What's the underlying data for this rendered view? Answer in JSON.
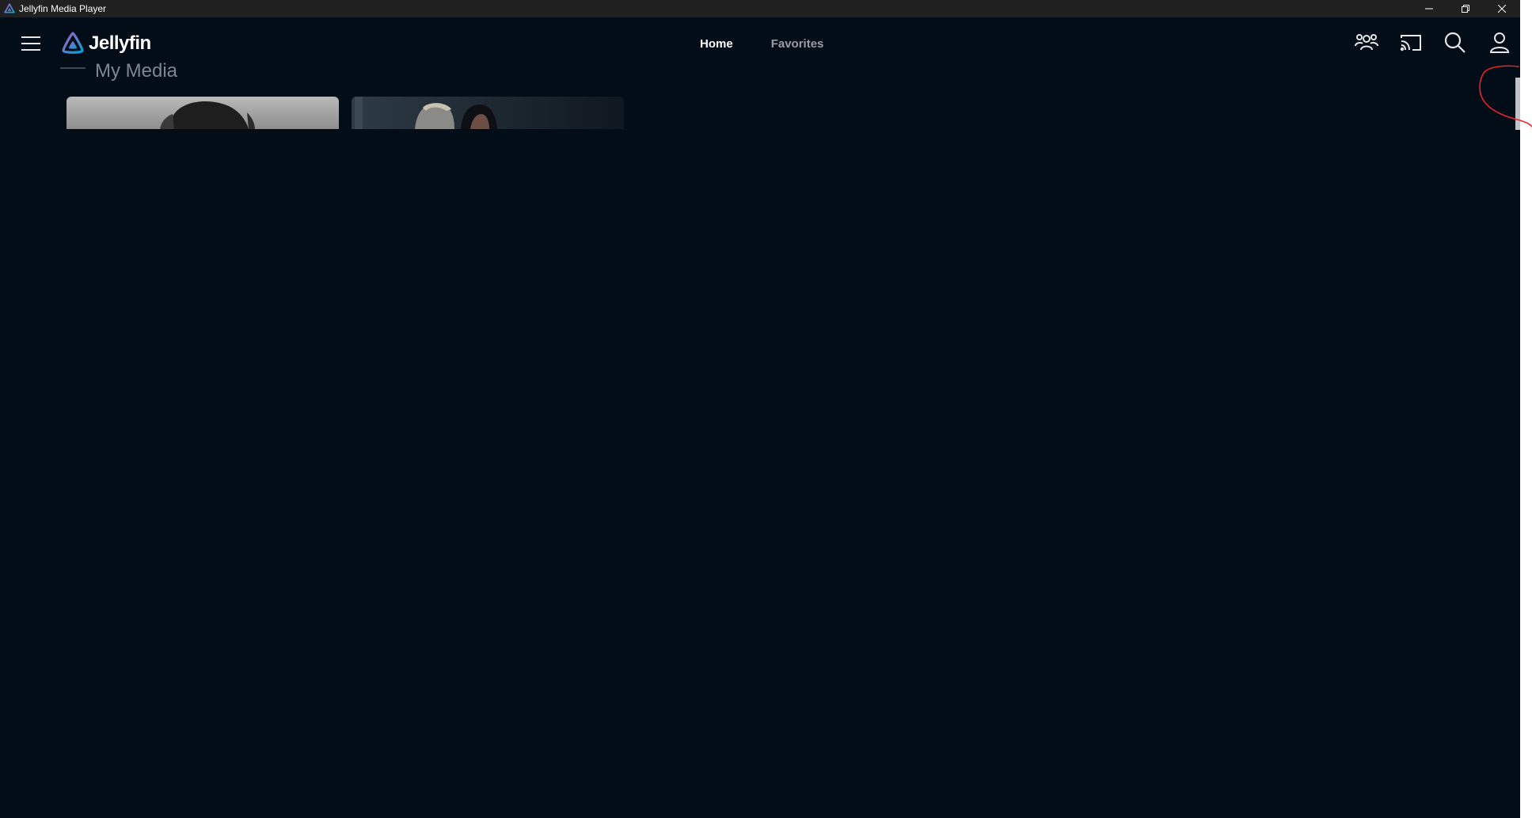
{
  "window": {
    "title": "Jellyfin Media Player"
  },
  "header": {
    "logo_text": "Jellyfin",
    "tabs": [
      {
        "label": "Home",
        "active": true
      },
      {
        "label": "Favorites",
        "active": false
      }
    ],
    "icons": [
      "users-icon",
      "cast-icon",
      "search-icon",
      "user-icon"
    ]
  },
  "main": {
    "section_title": "My Media"
  },
  "colors": {
    "background": "#020d18",
    "titlebar": "#202020",
    "accent_purple": "#aa5cc3",
    "accent_blue": "#00a4dc",
    "annotation_red": "#e8242b"
  }
}
